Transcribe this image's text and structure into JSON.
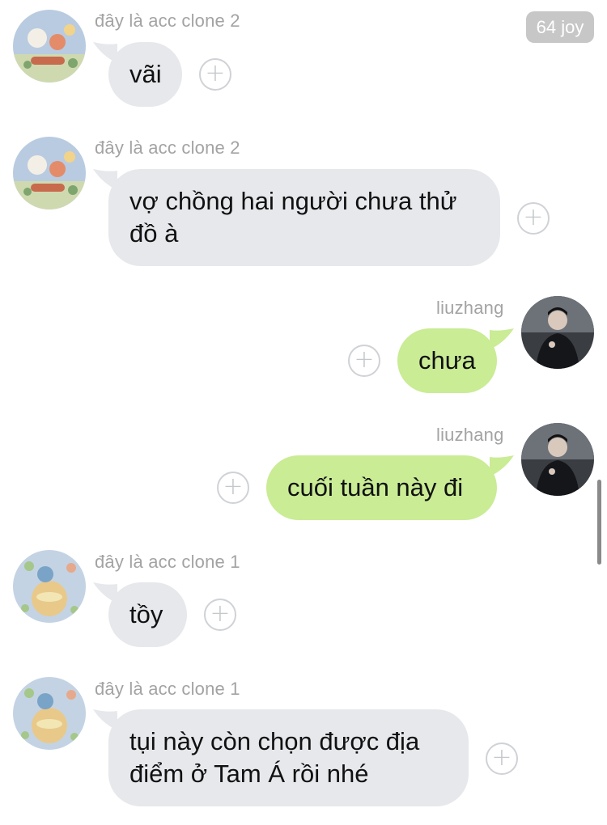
{
  "badge": {
    "label": "64 joy"
  },
  "react_symbol": "+",
  "messages": [
    {
      "sender": "đây là acc clone 2",
      "line1": "vãi",
      "line2": "",
      "direction": "incoming",
      "avatar": "illustration-avatar"
    },
    {
      "sender": "đây là acc clone 2",
      "line1": "vợ chồng hai người chưa thử",
      "line2": "đồ à",
      "direction": "incoming",
      "avatar": "illustration-avatar"
    },
    {
      "sender": "liuzhang",
      "line1": "chưa",
      "line2": "",
      "direction": "outgoing",
      "avatar": "photo-avatar"
    },
    {
      "sender": "liuzhang",
      "line1": "cuối tuần này đi",
      "line2": "",
      "direction": "outgoing",
      "avatar": "photo-avatar"
    },
    {
      "sender": "đây là acc clone 1",
      "line1": "tồy",
      "line2": "",
      "direction": "incoming",
      "avatar": "illustration-avatar"
    },
    {
      "sender": "đây là acc clone 1",
      "line1": "tụi này còn chọn được địa",
      "line2": "điểm ở Tam Á rồi nhé",
      "direction": "incoming",
      "avatar": "illustration-avatar"
    }
  ],
  "colors": {
    "incoming_bubble": "#e6e8ec",
    "outgoing_bubble": "#c9ec95",
    "sender_text": "#a3a3a3",
    "badge_bg": "#c7c7c7"
  }
}
